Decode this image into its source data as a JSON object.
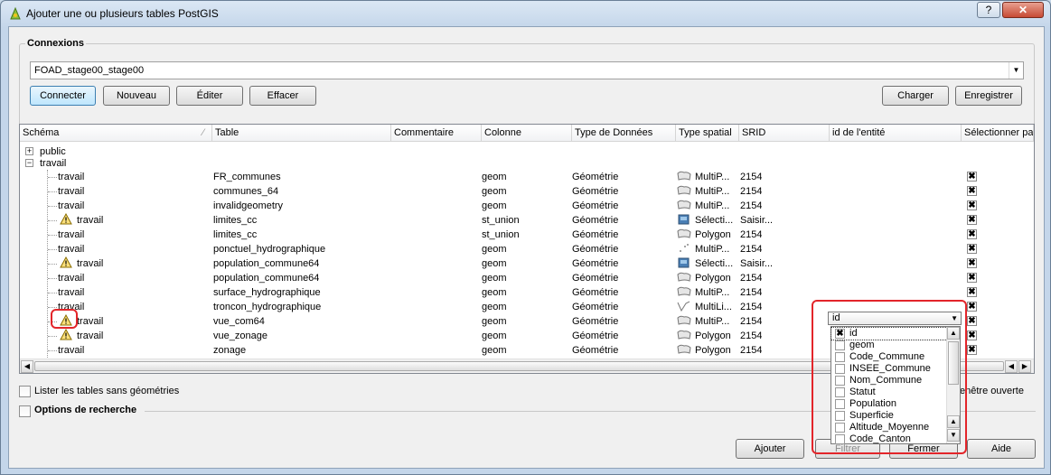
{
  "window": {
    "title": "Ajouter une ou plusieurs tables PostGIS",
    "help_button": "?",
    "close_button": "✕"
  },
  "connections": {
    "group_title": "Connexions",
    "selected_connection": "FOAD_stage00_stage00",
    "buttons": {
      "connect": "Connecter",
      "new": "Nouveau",
      "edit": "Éditer",
      "delete": "Effacer",
      "load": "Charger",
      "save": "Enregistrer"
    }
  },
  "table": {
    "headers": [
      "Schéma",
      "Table",
      "Commentaire",
      "Colonne",
      "Type de Données",
      "Type spatial",
      "SRID",
      "id de l'entité",
      "Sélectionner par"
    ],
    "schemas": [
      "public",
      "travail"
    ],
    "rows": [
      {
        "schema": "travail",
        "warn": false,
        "table": "FR_communes",
        "column": "geom",
        "datatype": "Géométrie",
        "spatial": "MultiP...",
        "spatial_icon": "polygon-icon",
        "srid": "2154"
      },
      {
        "schema": "travail",
        "warn": false,
        "table": "communes_64",
        "column": "geom",
        "datatype": "Géométrie",
        "spatial": "MultiP...",
        "spatial_icon": "polygon-icon",
        "srid": "2154"
      },
      {
        "schema": "travail",
        "warn": false,
        "table": "invalidgeometry",
        "column": "geom",
        "datatype": "Géométrie",
        "spatial": "MultiP...",
        "spatial_icon": "polygon-icon",
        "srid": "2154"
      },
      {
        "schema": "travail",
        "warn": true,
        "table": "limites_cc",
        "column": "st_union",
        "datatype": "Géométrie",
        "spatial": "Sélecti...",
        "spatial_icon": "select-icon",
        "srid": "Saisir..."
      },
      {
        "schema": "travail",
        "warn": false,
        "table": "limites_cc",
        "column": "st_union",
        "datatype": "Géométrie",
        "spatial": "Polygon",
        "spatial_icon": "polygon-icon",
        "srid": "2154"
      },
      {
        "schema": "travail",
        "warn": false,
        "table": "ponctuel_hydrographique",
        "column": "geom",
        "datatype": "Géométrie",
        "spatial": "MultiP...",
        "spatial_icon": "point-icon",
        "srid": "2154"
      },
      {
        "schema": "travail",
        "warn": true,
        "table": "population_commune64",
        "column": "geom",
        "datatype": "Géométrie",
        "spatial": "Sélecti...",
        "spatial_icon": "select-icon",
        "srid": "Saisir..."
      },
      {
        "schema": "travail",
        "warn": false,
        "table": "population_commune64",
        "column": "geom",
        "datatype": "Géométrie",
        "spatial": "Polygon",
        "spatial_icon": "polygon-icon",
        "srid": "2154"
      },
      {
        "schema": "travail",
        "warn": false,
        "table": "surface_hydrographique",
        "column": "geom",
        "datatype": "Géométrie",
        "spatial": "MultiP...",
        "spatial_icon": "polygon-icon",
        "srid": "2154"
      },
      {
        "schema": "travail",
        "warn": false,
        "table": "troncon_hydrographique",
        "column": "geom",
        "datatype": "Géométrie",
        "spatial": "MultiLi...",
        "spatial_icon": "line-icon",
        "srid": "2154"
      },
      {
        "schema": "travail",
        "warn": true,
        "table": "vue_com64",
        "column": "geom",
        "datatype": "Géométrie",
        "spatial": "MultiP...",
        "spatial_icon": "polygon-icon",
        "srid": "2154"
      },
      {
        "schema": "travail",
        "warn": true,
        "table": "vue_zonage",
        "column": "geom",
        "datatype": "Géométrie",
        "spatial": "Polygon",
        "spatial_icon": "polygon-icon",
        "srid": "2154"
      },
      {
        "schema": "travail",
        "warn": false,
        "table": "zonage",
        "column": "geom",
        "datatype": "Géométrie",
        "spatial": "Polygon",
        "spatial_icon": "polygon-icon",
        "srid": "2154"
      }
    ]
  },
  "feature_id_dropdown": {
    "selected": "id",
    "options": [
      {
        "label": "id",
        "checked": true
      },
      {
        "label": "geom",
        "checked": false
      },
      {
        "label": "Code_Commune",
        "checked": false
      },
      {
        "label": "INSEE_Commune",
        "checked": false
      },
      {
        "label": "Nom_Commune",
        "checked": false
      },
      {
        "label": "Statut",
        "checked": false
      },
      {
        "label": "Population",
        "checked": false
      },
      {
        "label": "Superficie",
        "checked": false
      },
      {
        "label": "Altitude_Moyenne",
        "checked": false
      },
      {
        "label": "Code_Canton",
        "checked": false
      }
    ]
  },
  "options": {
    "list_tables_without_geometry": "Lister les tables sans géométries",
    "keep_dialog_open_tail": "enêtre ouverte",
    "search_options": "Options de recherche"
  },
  "footer": {
    "add": "Ajouter",
    "filter": "Filtrer",
    "close": "Fermer",
    "help": "Aide"
  },
  "colors": {
    "highlight": "#e3252a",
    "window_frame": "#c4d6ea"
  }
}
